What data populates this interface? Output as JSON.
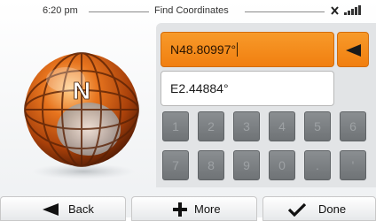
{
  "status_bar": {
    "time": "6:20 pm",
    "title": "Find Coordinates",
    "icons": [
      "satellite-icon",
      "signal-strength-icon"
    ]
  },
  "coords": {
    "latitude": "N48.80997°",
    "longitude": "E2.44884°"
  },
  "globe": {
    "letter": "N"
  },
  "keypad": {
    "row1": [
      "1",
      "2",
      "3",
      "4",
      "5",
      "6"
    ],
    "row2": [
      "7",
      "8",
      "9",
      "0",
      ".",
      "'"
    ],
    "enabled": false
  },
  "bottom_bar": {
    "back": "Back",
    "more": "More",
    "done": "Done"
  },
  "colors": {
    "accent": "#f28a18",
    "key_disabled": "#7a7e81"
  }
}
